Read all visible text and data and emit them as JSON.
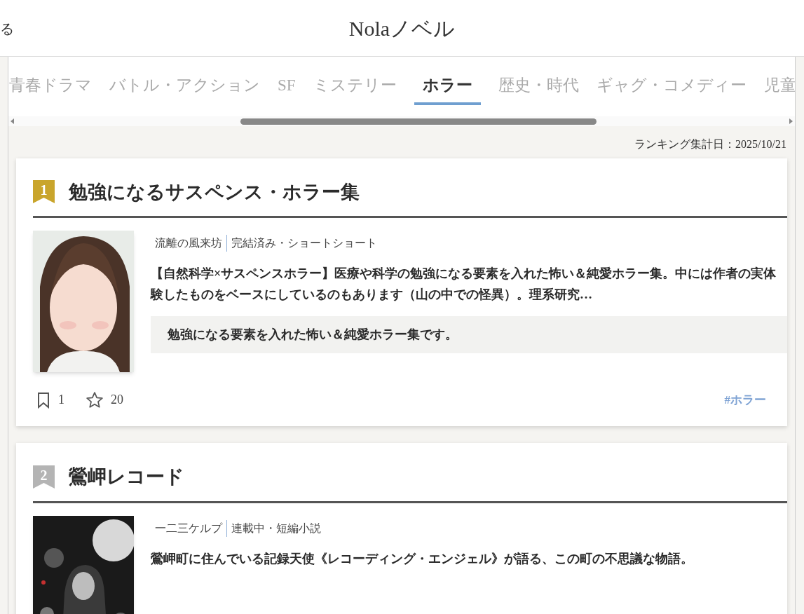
{
  "header": {
    "back_text": "る",
    "title": "Nolaノベル"
  },
  "tabs": [
    {
      "label": "青春ドラマ",
      "selected": false
    },
    {
      "label": "バトル・アクション",
      "selected": false
    },
    {
      "label": "SF",
      "selected": false
    },
    {
      "label": "ミステリー",
      "selected": false
    },
    {
      "label": "ホラー",
      "selected": true
    },
    {
      "label": "歴史・時代",
      "selected": false
    },
    {
      "label": "ギャグ・コメディー",
      "selected": false
    },
    {
      "label": "児童",
      "selected": false
    }
  ],
  "ranking_date": "ランキング集計日：2025/10/21",
  "works": [
    {
      "rank": "1",
      "color": "#c9a52c",
      "title": "勉強になるサスペンス・ホラー集",
      "author": "流離の風来坊",
      "status": "完結済み・ショートショート",
      "synopsis": "【自然科学×サスペンスホラー】医療や科学の勉強になる要素を入れた怖い＆純愛ホラー集。中には作者の実体験したものをベースにしているのもあります（山の中での怪異）。理系研究…",
      "catchphrase": "勉強になる要素を入れた怖い＆純愛ホラー集です。",
      "bookmarks": "1",
      "stars_count": "20",
      "tags": [
        "#ホラー"
      ]
    },
    {
      "rank": "2",
      "color": "#b4b4b4",
      "title": "鶯岬レコード",
      "author": "一二三ケルプ",
      "status": "連載中・短編小説",
      "synopsis": "鶯岬町に住んでいる記録天使《レコーディング・エンジェル》が語る、この町の不思議な物語。"
    }
  ]
}
